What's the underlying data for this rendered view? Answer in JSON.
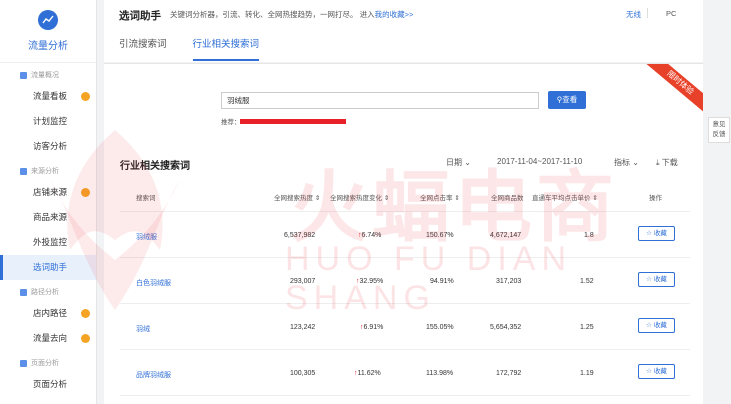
{
  "sidebar": {
    "brand": "流量分析",
    "groups": [
      {
        "label": "流量概况",
        "items": [
          {
            "label": "流量看板",
            "dot": true
          },
          {
            "label": "计划监控",
            "dot": false
          },
          {
            "label": "访客分析",
            "dot": false
          }
        ]
      },
      {
        "label": "来源分析",
        "items": [
          {
            "label": "店铺来源",
            "dot": true
          },
          {
            "label": "商品来源",
            "dot": false
          },
          {
            "label": "外投监控",
            "dot": false
          },
          {
            "label": "选词助手",
            "dot": false,
            "active": true
          }
        ]
      },
      {
        "label": "路径分析",
        "items": [
          {
            "label": "店内路径",
            "dot": true
          },
          {
            "label": "流量去向",
            "dot": true
          }
        ]
      },
      {
        "label": "页面分析",
        "items": [
          {
            "label": "页面分析",
            "dot": false
          }
        ]
      }
    ]
  },
  "header": {
    "title": "选词助手",
    "desc": "关键词分析器，引流、转化、全网热搜趋势，一网打尽。 进入",
    "collect_link": "我的收藏>>",
    "wireless": "无线",
    "pc": "PC",
    "tabs": [
      "引流搜索词",
      "行业相关搜索词"
    ]
  },
  "search": {
    "value": "羽绒服",
    "button": "查看",
    "recommend": "推荐："
  },
  "ribbon": "限时体验",
  "section": {
    "title": "行业相关搜索词",
    "date_label": "日期",
    "date_range": "2017-11-04~2017-11-10",
    "metric_label": "指标",
    "download": "下载"
  },
  "table": {
    "headers": [
      "搜索词",
      "全网搜索热度",
      "全网搜索热度变化",
      "全网点击率",
      "全网商品数",
      "直通车平均点击单价",
      "操作"
    ],
    "collect_label": "收藏",
    "rows": [
      {
        "kw": "羽绒服",
        "heat": "6,537,982",
        "change": "6.74%",
        "ctr": "150.67%",
        "items": "4,672,147",
        "cpc": "1.8"
      },
      {
        "kw": "白色羽绒服",
        "heat": "293,007",
        "change": "32.95%",
        "ctr": "94.91%",
        "items": "317,203",
        "cpc": "1.52"
      },
      {
        "kw": "羽绒",
        "heat": "123,242",
        "change": "6.91%",
        "ctr": "155.05%",
        "items": "5,654,352",
        "cpc": "1.25"
      },
      {
        "kw": "品牌羽绒服",
        "heat": "100,305",
        "change": "11.62%",
        "ctr": "113.98%",
        "items": "172,792",
        "cpc": "1.19"
      }
    ]
  },
  "watermark": {
    "cn": "火蝠电商",
    "en": "HUO FU DIAN SHANG"
  },
  "feedback": [
    "意见",
    "反馈"
  ]
}
